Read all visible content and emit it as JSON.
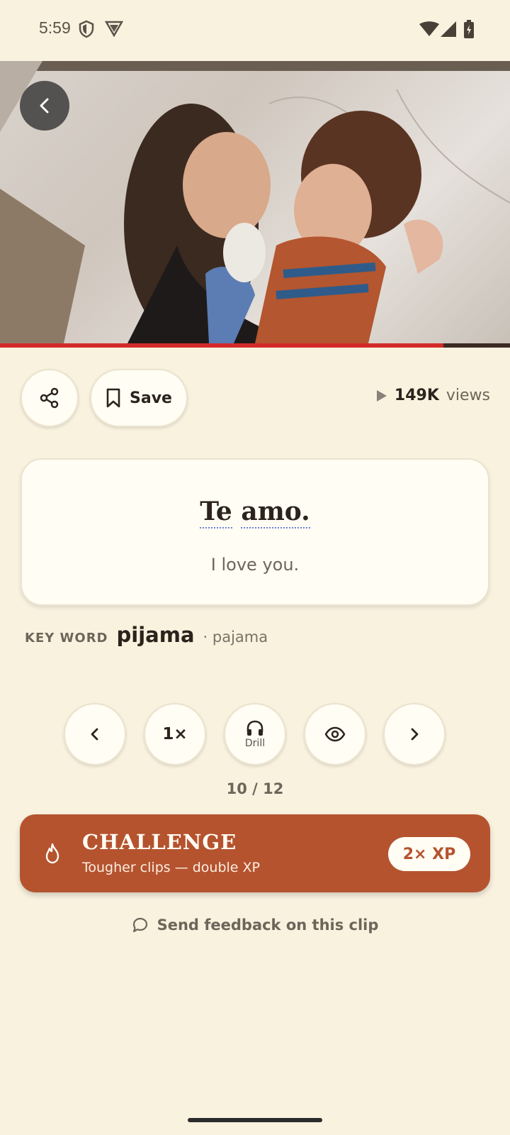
{
  "status_bar": {
    "time": "5:59",
    "left_icons": [
      "shield-icon",
      "vpn-icon"
    ],
    "right_icons": [
      "wifi-icon",
      "signal-icon",
      "battery-icon"
    ]
  },
  "video": {
    "progress_fraction": 0.87,
    "progress_color": "#d42a2a"
  },
  "actions": {
    "save_label": "Save",
    "views_count": "149K",
    "views_label": "views"
  },
  "phrase": {
    "words": [
      "Te",
      "amo."
    ],
    "translation": "I love you."
  },
  "keyword": {
    "tag": "KEY WORD",
    "word": "pijama",
    "gloss": "· pajama"
  },
  "controls": {
    "speed_label": "1×",
    "drill_label": "Drill",
    "counter": "10 / 12"
  },
  "challenge": {
    "title": "CHALLENGE",
    "subtitle": "Tougher clips — double XP",
    "badge": "2× XP",
    "color": "#b5532f"
  },
  "feedback": {
    "label": "Send feedback on this clip"
  },
  "colors": {
    "background": "#f9f2df",
    "card": "#fffdf4",
    "accent": "#b5532f"
  }
}
